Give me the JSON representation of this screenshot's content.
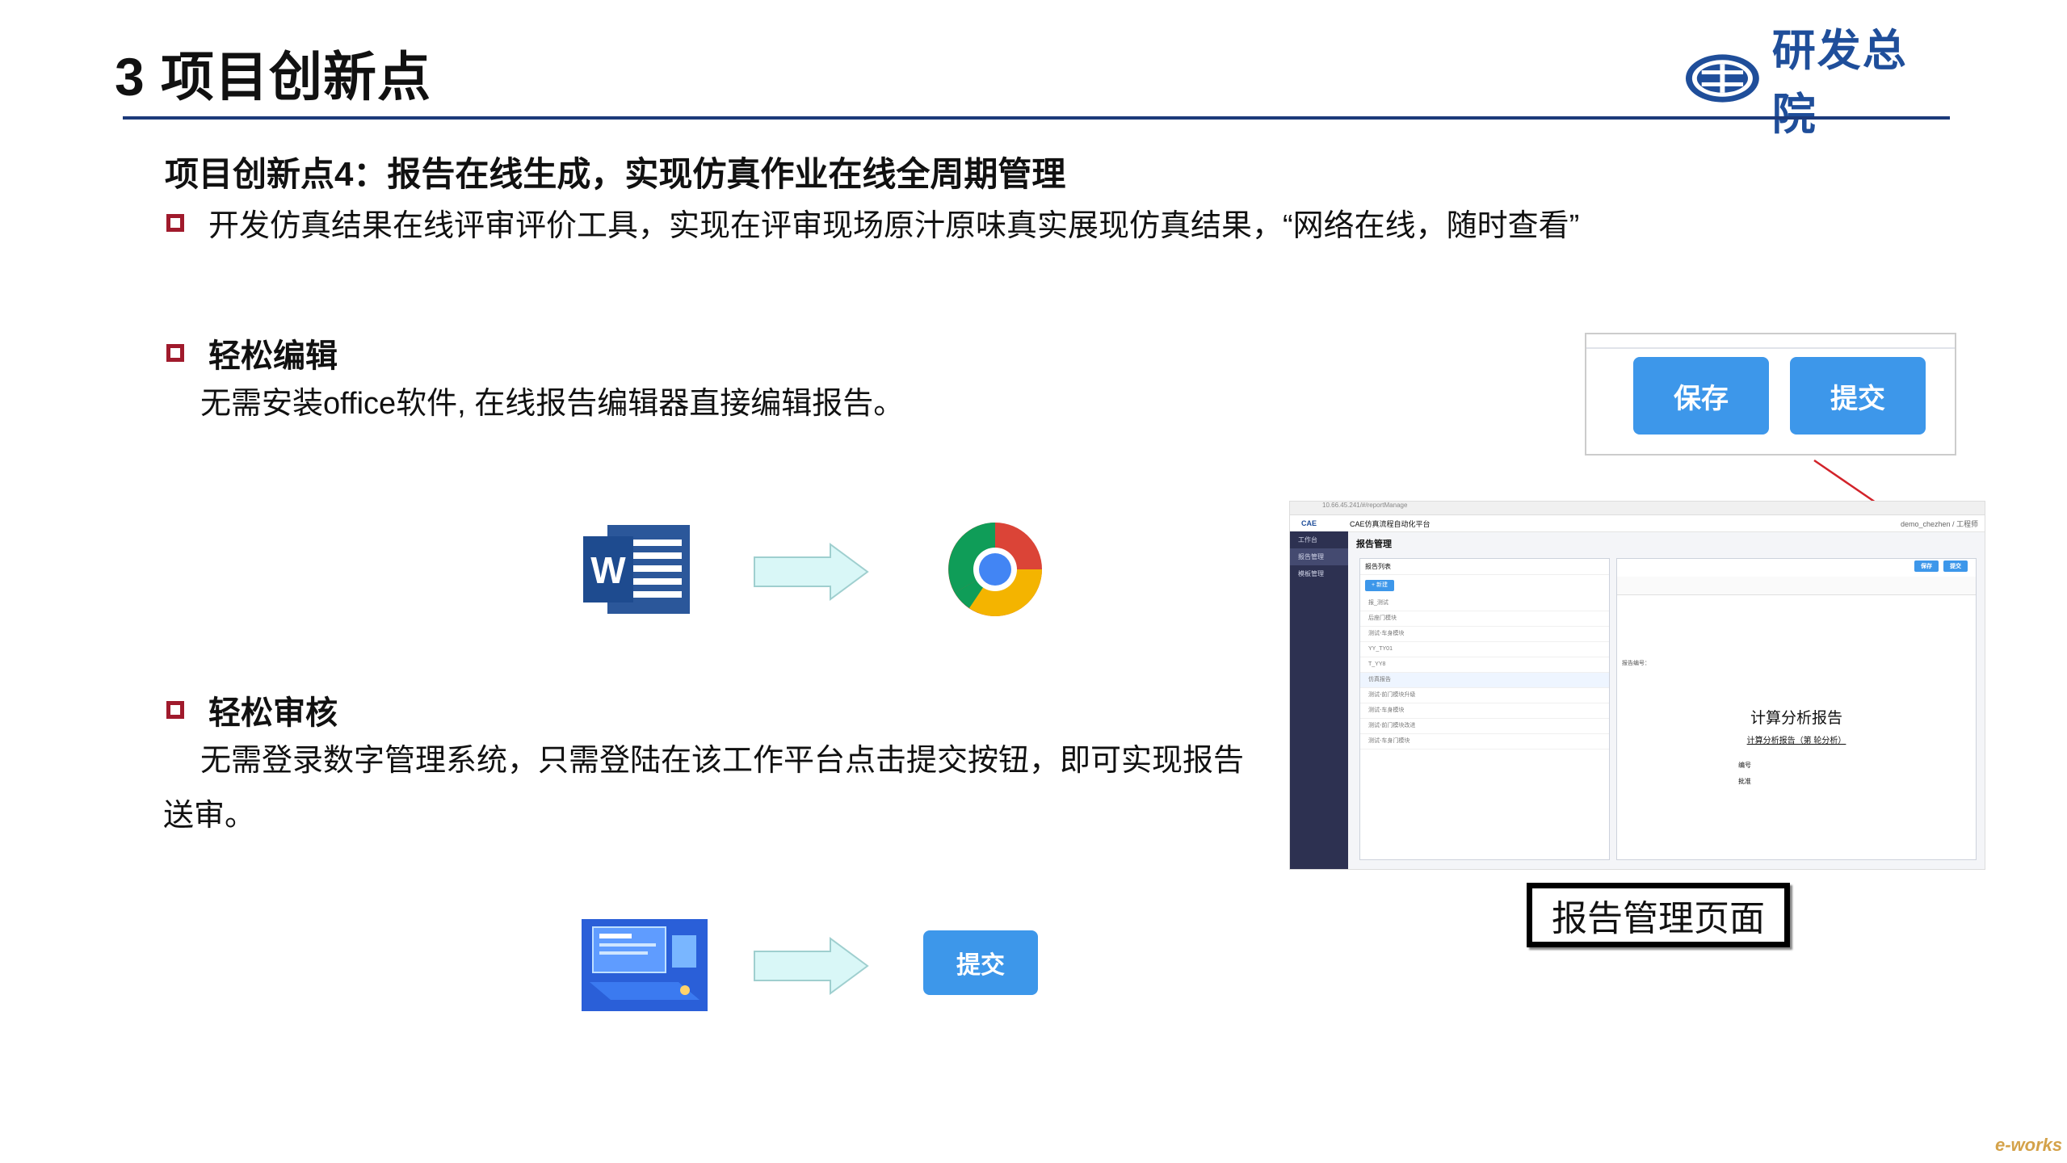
{
  "slide": {
    "title": "3 项目创新点",
    "logo_text": "研发总院",
    "subtitle": "项目创新点4：报告在线生成，实现仿真作业在线全周期管理",
    "intro_bullet": "开发仿真结果在线评审评价工具，实现在评审现场原汁原味真实展现仿真结果，“网络在线，随时查看”"
  },
  "section_edit": {
    "heading": "轻松编辑",
    "text": "无需安装office软件, 在线报告编辑器直接编辑报告。",
    "from_icon": "word-icon",
    "to_icon": "chrome-icon"
  },
  "section_review": {
    "heading": "轻松审核",
    "text_line1": "无需登录数字管理系统，只需登陆在该工作平台点击提交按钮，即可实现报告",
    "text_line2": "送审。",
    "from_icon": "digital-platform-illustration",
    "submit_label": "提交"
  },
  "zoom_box": {
    "save_label": "保存",
    "submit_label": "提交"
  },
  "screenshot": {
    "url": "10.66.45.241/#/reportManage",
    "app_title": "CAE仿真流程自动化平台",
    "user": "demo_chezhen / 工程师",
    "nav": [
      "工作台",
      "报告管理",
      "模板管理"
    ],
    "page_title": "报告管理",
    "list_title": "报告列表",
    "new_label": "+ 新建",
    "list_rows": [
      "报_测试",
      "后座门模块",
      "测试-车身模块",
      "YY_TY01",
      "T_YY8",
      "仿真报告",
      "测试-前门模块升级",
      "测试-车身模块",
      "测试-前门模块改进",
      "测试-车身门模块"
    ],
    "report_heading": "计算分析报告",
    "report_subline": "计算分析报告（第  轮分析）",
    "field_code": "报告编号：",
    "field_id": "编号",
    "field_approve": "批准",
    "btn_save": "保存",
    "btn_submit": "提交"
  },
  "caption": "报告管理页面",
  "watermark": "e-works",
  "colors": {
    "accent_blue": "#3d97ea",
    "bullet_red": "#a01a2c",
    "rule_navy": "#1c3a7a",
    "logo_blue": "#1f4e9a"
  }
}
